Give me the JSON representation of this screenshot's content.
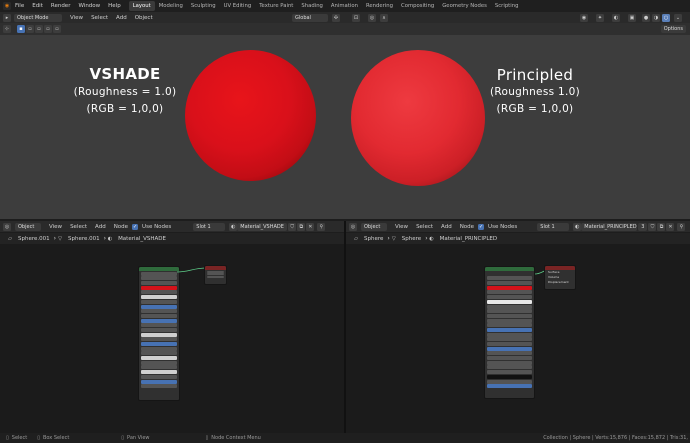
{
  "topbar": {
    "menus": [
      "File",
      "Edit",
      "Render",
      "Window",
      "Help"
    ],
    "workspaces": [
      "Layout",
      "Modeling",
      "Sculpting",
      "UV Editing",
      "Texture Paint",
      "Shading",
      "Animation",
      "Rendering",
      "Compositing",
      "Geometry Nodes",
      "Scripting"
    ],
    "active_workspace": "Layout"
  },
  "viewport_header": {
    "mode": "Object Mode",
    "menus": [
      "View",
      "Select",
      "Add",
      "Object"
    ],
    "transform_orientation": "Global",
    "options_label": "Options"
  },
  "viewport": {
    "left_title": "VSHADE",
    "left_line1": "(Roughness = 1.0)",
    "left_line2": "(RGB = 1,0,0)",
    "right_title": "Principled",
    "right_line1": "(Roughness 1.0)",
    "right_line2": "(RGB = 1,0,0)",
    "sphere_color": "#d4121a"
  },
  "node_editor_left": {
    "type": "Object",
    "menus": [
      "View",
      "Select",
      "Add",
      "Node"
    ],
    "use_nodes": "Use Nodes",
    "slot": "Slot 1",
    "material": "Material_VSHADE",
    "breadcrumb": [
      "Sphere.001",
      "Sphere.001",
      "Material_VSHADE"
    ]
  },
  "node_editor_right": {
    "type": "Object",
    "menus": [
      "View",
      "Select",
      "Add",
      "Node"
    ],
    "use_nodes": "Use Nodes",
    "slot": "Slot 1",
    "material": "Material_PRINCIPLED",
    "user_count": "3",
    "breadcrumb": [
      "Sphere",
      "Sphere",
      "Material_PRINCIPLED"
    ],
    "output_sockets": [
      "Surface",
      "Volume",
      "Displacement"
    ]
  },
  "statusbar": {
    "select": "Select",
    "box_select": "Box Select",
    "pan_view": "Pan View",
    "context_menu": "Node Context Menu",
    "stats": "Collection | Sphere | Verts:15,876 | Faces:15,872 | Tris:31,"
  }
}
